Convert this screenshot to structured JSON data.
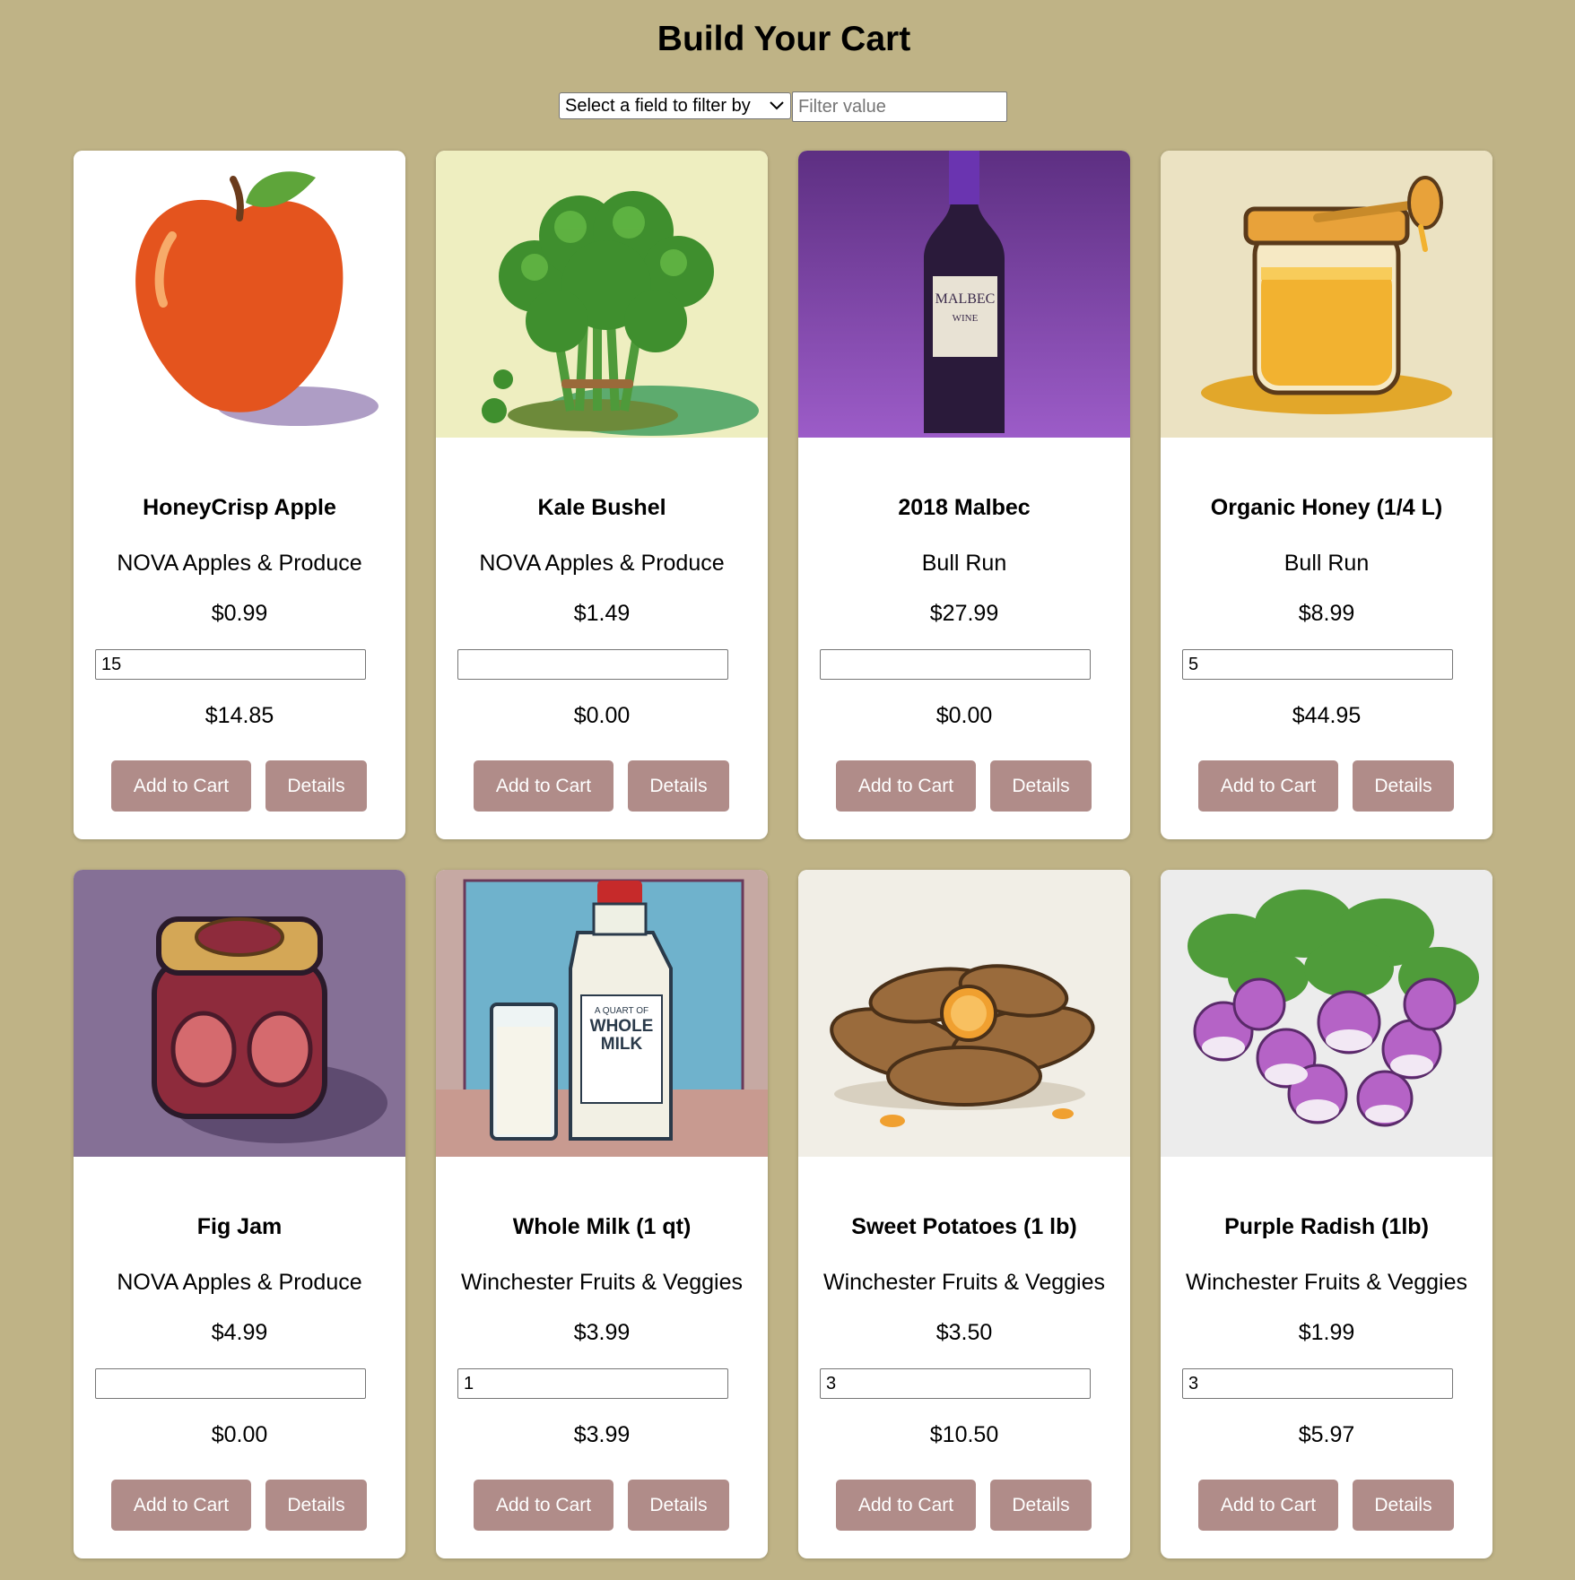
{
  "page": {
    "title": "Build Your Cart"
  },
  "filter": {
    "select_label": "Select a field to filter by",
    "input_placeholder": "Filter value",
    "input_value": ""
  },
  "products": [
    {
      "name": "HoneyCrisp Apple",
      "vendor": "NOVA Apples & Produce",
      "price": "$0.99",
      "quantity": "15",
      "total": "$14.85",
      "add_label": "Add to Cart",
      "details_label": "Details"
    },
    {
      "name": "Kale Bushel",
      "vendor": "NOVA Apples & Produce",
      "price": "$1.49",
      "quantity": "",
      "total": "$0.00",
      "add_label": "Add to Cart",
      "details_label": "Details"
    },
    {
      "name": "2018 Malbec",
      "vendor": "Bull Run",
      "price": "$27.99",
      "quantity": "",
      "total": "$0.00",
      "add_label": "Add to Cart",
      "details_label": "Details",
      "image_text": [
        "MALBEC",
        "WINE"
      ]
    },
    {
      "name": "Organic Honey (1/4 L)",
      "vendor": "Bull Run",
      "price": "$8.99",
      "quantity": "5",
      "total": "$44.95",
      "add_label": "Add to Cart",
      "details_label": "Details"
    },
    {
      "name": "Fig Jam",
      "vendor": "NOVA Apples & Produce",
      "price": "$4.99",
      "quantity": "",
      "total": "$0.00",
      "add_label": "Add to Cart",
      "details_label": "Details"
    },
    {
      "name": "Whole Milk (1 qt)",
      "vendor": "Winchester Fruits & Veggies",
      "price": "$3.99",
      "quantity": "1",
      "total": "$3.99",
      "add_label": "Add to Cart",
      "details_label": "Details",
      "image_text": [
        "A QUART OF",
        "WHOLE",
        "MILK"
      ]
    },
    {
      "name": "Sweet Potatoes (1 lb)",
      "vendor": "Winchester Fruits & Veggies",
      "price": "$3.50",
      "quantity": "3",
      "total": "$10.50",
      "add_label": "Add to Cart",
      "details_label": "Details"
    },
    {
      "name": "Purple Radish (1lb)",
      "vendor": "Winchester Fruits & Veggies",
      "price": "$1.99",
      "quantity": "3",
      "total": "$5.97",
      "add_label": "Add to Cart",
      "details_label": "Details"
    }
  ]
}
